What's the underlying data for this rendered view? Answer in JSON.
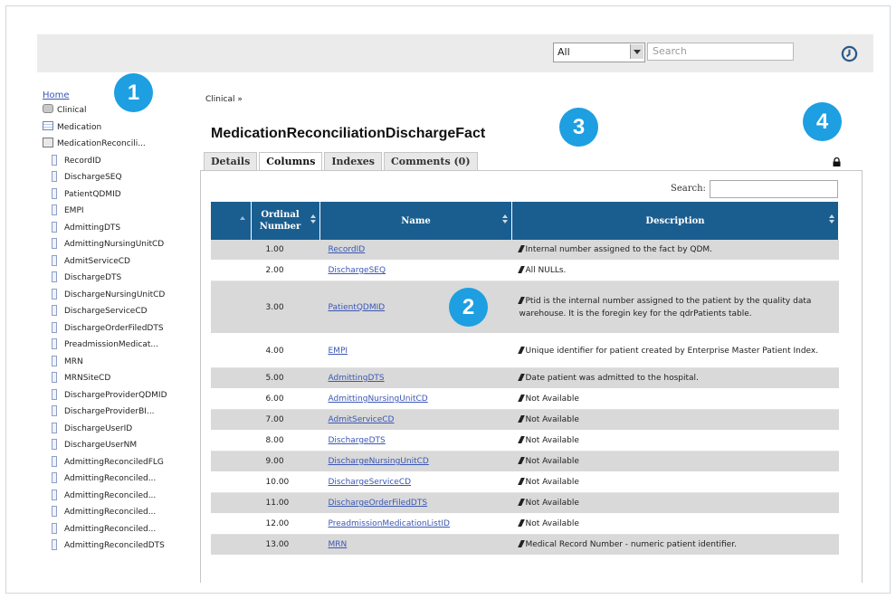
{
  "header": {
    "filter_value": "All",
    "search_placeholder": "Search"
  },
  "sidebar": {
    "home_label": "Home",
    "items": [
      {
        "label": "Clinical",
        "icon": "database-icon"
      },
      {
        "label": "Medication",
        "icon": "table-icon"
      },
      {
        "label": "MedicationReconcili...",
        "icon": "fact-table-icon"
      },
      {
        "label": "RecordID",
        "icon": "column-icon"
      },
      {
        "label": "DischargeSEQ",
        "icon": "column-icon"
      },
      {
        "label": "PatientQDMID",
        "icon": "column-icon"
      },
      {
        "label": "EMPI",
        "icon": "column-icon"
      },
      {
        "label": "AdmittingDTS",
        "icon": "column-icon"
      },
      {
        "label": "AdmittingNursingUnitCD",
        "icon": "column-icon"
      },
      {
        "label": "AdmitServiceCD",
        "icon": "column-icon"
      },
      {
        "label": "DischargeDTS",
        "icon": "column-icon"
      },
      {
        "label": "DischargeNursingUnitCD",
        "icon": "column-icon"
      },
      {
        "label": "DischargeServiceCD",
        "icon": "column-icon"
      },
      {
        "label": "DischargeOrderFiledDTS",
        "icon": "column-icon"
      },
      {
        "label": "PreadmissionMedicat...",
        "icon": "column-icon"
      },
      {
        "label": "MRN",
        "icon": "column-icon"
      },
      {
        "label": "MRNSiteCD",
        "icon": "column-icon"
      },
      {
        "label": "DischargeProviderQDMID",
        "icon": "column-icon"
      },
      {
        "label": "DischargeProviderBI...",
        "icon": "column-icon"
      },
      {
        "label": "DischargeUserID",
        "icon": "column-icon"
      },
      {
        "label": "DischargeUserNM",
        "icon": "column-icon"
      },
      {
        "label": "AdmittingReconciledFLG",
        "icon": "column-icon"
      },
      {
        "label": "AdmittingReconciled...",
        "icon": "column-icon"
      },
      {
        "label": "AdmittingReconciled...",
        "icon": "column-icon"
      },
      {
        "label": "AdmittingReconciled...",
        "icon": "column-icon"
      },
      {
        "label": "AdmittingReconciled...",
        "icon": "column-icon"
      },
      {
        "label": "AdmittingReconciledDTS",
        "icon": "column-icon"
      }
    ]
  },
  "main": {
    "breadcrumb": "Clinical »",
    "title": "MedicationReconciliationDischargeFact",
    "tabs": [
      {
        "label": "Details",
        "active": false
      },
      {
        "label": "Columns",
        "active": true
      },
      {
        "label": "Indexes",
        "active": false
      },
      {
        "label": "Comments (0)",
        "active": false
      }
    ],
    "table_search_label": "Search:",
    "columns": [
      "",
      "Ordinal Number",
      "Name",
      "Description"
    ],
    "rows": [
      {
        "num": "1.00",
        "name": "RecordID",
        "desc": "Internal number assigned to the fact by QDM."
      },
      {
        "num": "2.00",
        "name": "DischargeSEQ",
        "desc": "All NULLs."
      },
      {
        "num": "3.00",
        "name": "PatientQDMID",
        "desc": "Ptid is the internal number assigned to the patient by the quality data warehouse. It is the foregin key for the qdrPatients table."
      },
      {
        "num": "4.00",
        "name": "EMPI",
        "desc": "Unique identifier for patient created by Enterprise Master Patient Index."
      },
      {
        "num": "5.00",
        "name": "AdmittingDTS",
        "desc": "Date patient was admitted to the hospital."
      },
      {
        "num": "6.00",
        "name": "AdmittingNursingUnitCD",
        "desc": "Not Available"
      },
      {
        "num": "7.00",
        "name": "AdmitServiceCD",
        "desc": "Not Available"
      },
      {
        "num": "8.00",
        "name": "DischargeDTS",
        "desc": "Not Available"
      },
      {
        "num": "9.00",
        "name": "DischargeNursingUnitCD",
        "desc": "Not Available"
      },
      {
        "num": "10.00",
        "name": "DischargeServiceCD",
        "desc": "Not Available"
      },
      {
        "num": "11.00",
        "name": "DischargeOrderFiledDTS",
        "desc": "Not Available"
      },
      {
        "num": "12.00",
        "name": "PreadmissionMedicationListID",
        "desc": "Not Available"
      },
      {
        "num": "13.00",
        "name": "MRN",
        "desc": "Medical Record Number - numeric patient identifier."
      }
    ]
  },
  "callouts": [
    "1",
    "2",
    "3",
    "4"
  ],
  "colors": {
    "header_blue": "#1a5e90",
    "badge_blue": "#1d9fe1",
    "link_blue": "#3a56b5",
    "row_gray": "#d9d9d9"
  }
}
